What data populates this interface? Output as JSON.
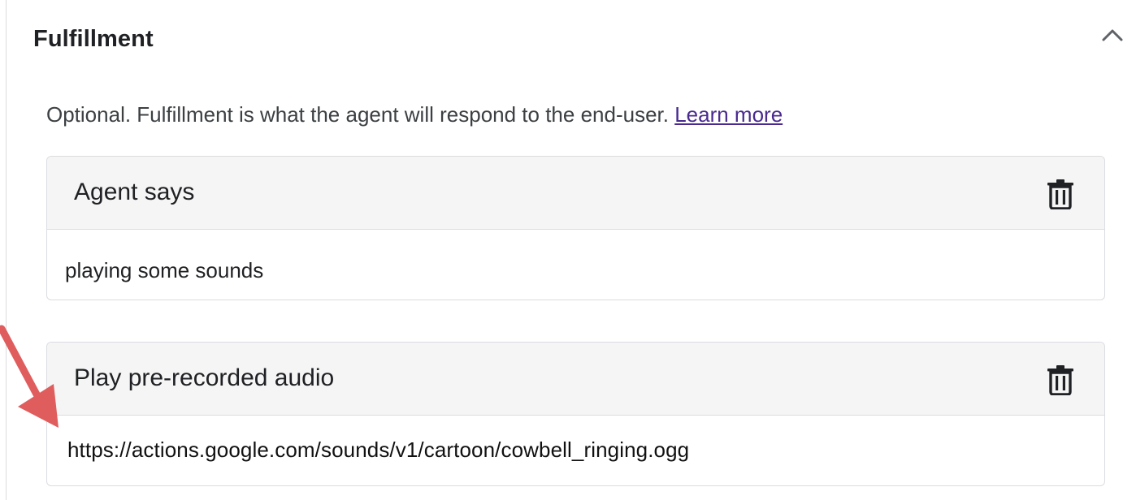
{
  "section": {
    "title": "Fulfillment",
    "collapse_icon": "chevron-up-icon"
  },
  "description": {
    "text": "Optional. Fulfillment is what the agent will respond to the end-user. ",
    "link_label": "Learn more"
  },
  "cards": [
    {
      "title": "Agent says",
      "value": "playing some sounds",
      "delete_icon": "trash-icon"
    },
    {
      "title": "Play pre-recorded audio",
      "value": "https://actions.google.com/sounds/v1/cartoon/cowbell_ringing.ogg",
      "delete_icon": "trash-icon"
    }
  ],
  "annotation": {
    "arrow_color": "#e05d5d"
  },
  "colors": {
    "link": "#4a2a8f",
    "card_header_bg": "#f5f5f5",
    "border": "#dadce0"
  }
}
